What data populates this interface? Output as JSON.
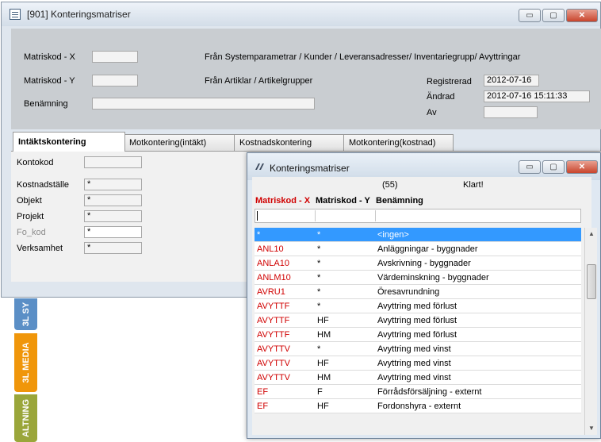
{
  "main_window": {
    "title": "[901]  Konteringsmatriser",
    "buttons": {
      "minimize": "▭",
      "maximize": "▢",
      "close": "✕"
    },
    "fields": {
      "matriskod_x_label": "Matriskod - X",
      "matriskod_y_label": "Matriskod - Y",
      "benamning_label": "Benämning",
      "x_source": "Från Systemparametrar / Kunder / Leveransadresser/ Inventariegrupp/ Avyttringar",
      "y_source": "Från  Artiklar / Artikelgrupper",
      "registrerad_label": "Registrerad",
      "registrerad_value": "2012-07-16",
      "andrad_label": "Ändrad",
      "andrad_value": "2012-07-16 15:11:33",
      "av_label": "Av",
      "av_value": ""
    },
    "tabs": [
      "Intäktskontering",
      "Motkontering(intäkt)",
      "Kostnadskontering",
      "Motkontering(kostnad)"
    ],
    "tab_fields": {
      "kontokod": "Kontokod",
      "kostnadsstalle": "Kostnadställe",
      "objekt": "Objekt",
      "projekt": "Projekt",
      "fo_kod": "Fo_kod",
      "verksamhet": "Verksamhet",
      "asterisk": "*"
    }
  },
  "side_tabs": [
    "3L SY",
    "3L MEDIA",
    "ALTNING"
  ],
  "popup": {
    "title": "Konteringsmatriser",
    "count": "(55)",
    "status": "Klart!",
    "columns": [
      "Matriskod - X",
      "Matriskod - Y",
      "Benämning"
    ],
    "rows": [
      [
        "*",
        "*",
        "<ingen>"
      ],
      [
        "ANL10",
        "*",
        "Anläggningar - byggnader"
      ],
      [
        "ANLA10",
        "*",
        "Avskrivning - byggnader"
      ],
      [
        "ANLM10",
        "*",
        "Värdeminskning - byggnader"
      ],
      [
        "AVRU1",
        "*",
        "Öresavrundning"
      ],
      [
        "AVYTTF",
        "*",
        "Avyttring med förlust"
      ],
      [
        "AVYTTF",
        "HF",
        "Avyttring med förlust"
      ],
      [
        "AVYTTF",
        "HM",
        "Avyttring med förlust"
      ],
      [
        "AVYTTV",
        "*",
        "Avyttring med vinst"
      ],
      [
        "AVYTTV",
        "HF",
        "Avyttring med vinst"
      ],
      [
        "AVYTTV",
        "HM",
        "Avyttring med vinst"
      ],
      [
        "EF",
        "F",
        "Förrådsförsäljning - externt"
      ],
      [
        "EF",
        "HF",
        "Fordonshyra - externt"
      ]
    ]
  }
}
